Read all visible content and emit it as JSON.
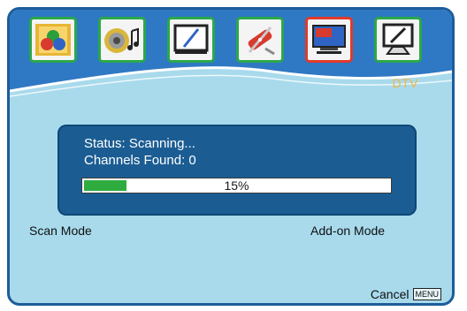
{
  "header": {
    "section_label": "DTV",
    "tiles": [
      {
        "name": "picture-icon",
        "selected": false
      },
      {
        "name": "sound-icon",
        "selected": false
      },
      {
        "name": "monitor-icon",
        "selected": false
      },
      {
        "name": "tools-icon",
        "selected": false
      },
      {
        "name": "dtv-icon",
        "selected": true,
        "badge": "DTV"
      },
      {
        "name": "pc-input-icon",
        "selected": false
      }
    ]
  },
  "scan": {
    "status": "Status: Scanning...",
    "channels": "Channels Found: 0",
    "progress_percent": 15,
    "progress_label": "15%"
  },
  "modes": {
    "scan_mode": "Scan Mode",
    "addon_mode": "Add-on Mode"
  },
  "footer": {
    "cancel_label": "Cancel",
    "cancel_key": "MENU"
  },
  "colors": {
    "background": "#a8daec",
    "panel": "#1b5d93",
    "progress": "#2fac3f",
    "selected_border": "#e23a2a",
    "tile_border": "#2aa84a",
    "accent_label": "#f2b63d"
  }
}
